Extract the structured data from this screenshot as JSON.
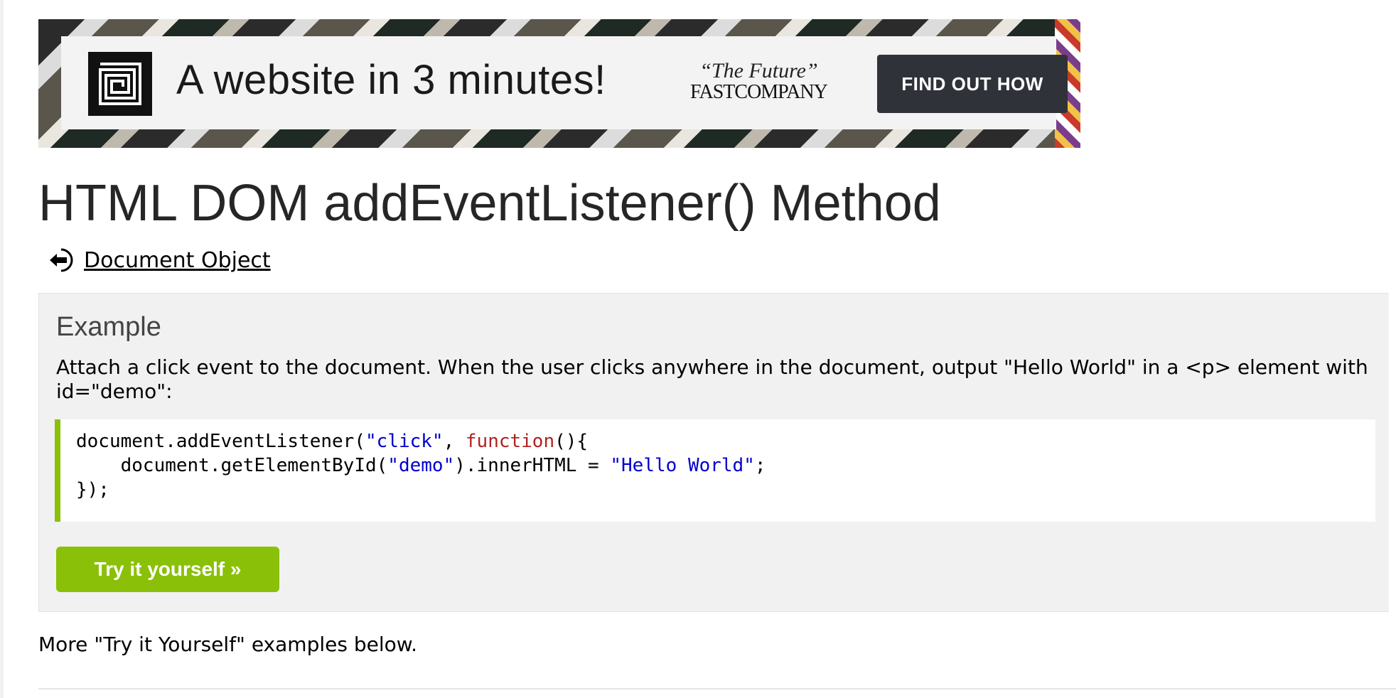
{
  "ad": {
    "headline": "A website in 3 minutes!",
    "quote": "“The Future”",
    "quote_source": "FASTCOMPANY",
    "cta_label": "FIND OUT HOW",
    "logo_icon": "square-spiral-logo-icon",
    "choices_icon": "ad-choices-icon"
  },
  "page": {
    "title": "HTML DOM addEventListener() Method",
    "back_link_label": " Document Object",
    "back_icon": "back-arrow-icon"
  },
  "example": {
    "heading": "Example",
    "description": "Attach a click event to the document. When the user clicks anywhere in the document, output \"Hello World\" in a <p> element with id=\"demo\":",
    "code": {
      "line1_a": "document.addEventListener(",
      "line1_str": "\"click\"",
      "line1_b": ", ",
      "line1_kw": "function",
      "line1_c": "(){",
      "line2_a": "    document.getElementById(",
      "line2_str1": "\"demo\"",
      "line2_b": ").innerHTML = ",
      "line2_str2": "\"Hello World\"",
      "line2_c": ";",
      "line3": "});"
    },
    "try_button_label": "Try it yourself »"
  },
  "footer": {
    "more_text": "More \"Try it Yourself\" examples below."
  },
  "colors": {
    "accent_green": "#8ac007",
    "example_bg": "#f1f1f1",
    "string_blue": "#0000cd",
    "keyword_red": "#b22222",
    "cta_dark": "#2f3238"
  }
}
